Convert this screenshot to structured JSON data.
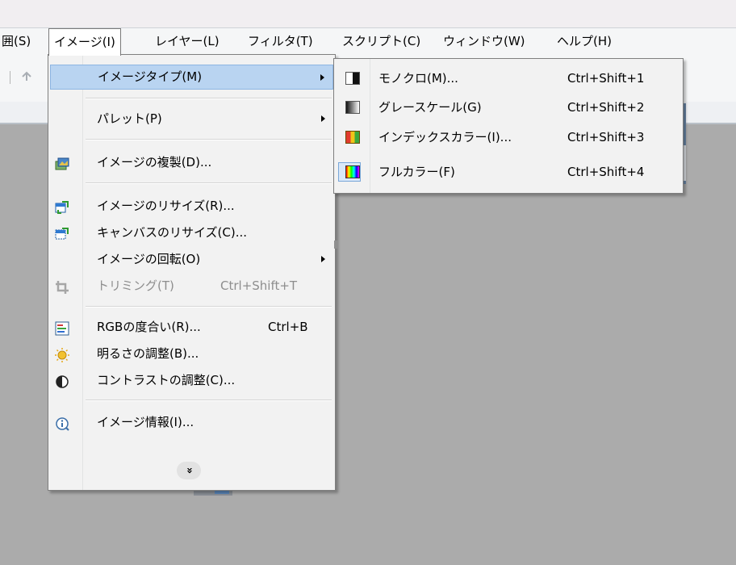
{
  "menubar": {
    "items": [
      {
        "label": "囲(S)"
      },
      {
        "label": "イメージ(I)"
      },
      {
        "label": "レイヤー(L)"
      },
      {
        "label": "フィルタ(T)"
      },
      {
        "label": "スクリプト(C)"
      },
      {
        "label": "ウィンドウ(W)"
      },
      {
        "label": "ヘルプ(H)"
      }
    ],
    "active_index": 1
  },
  "image_menu": {
    "items": [
      {
        "label": "イメージタイプ(M)",
        "has_submenu": true,
        "highlighted": true
      },
      {
        "label": "パレット(P)",
        "has_submenu": true
      },
      {
        "label": "イメージの複製(D)...",
        "icon": "duplicate-image-icon"
      },
      {
        "label": "イメージのリサイズ(R)...",
        "icon": "resize-image-icon"
      },
      {
        "label": "キャンバスのリサイズ(C)...",
        "icon": "resize-canvas-icon"
      },
      {
        "label": "イメージの回転(O)",
        "has_submenu": true
      },
      {
        "label": "トリミング(T)",
        "shortcut": "Ctrl+Shift+T",
        "icon": "crop-icon",
        "disabled": true
      },
      {
        "label": "RGBの度合い(R)...",
        "shortcut": "Ctrl+B",
        "icon": "rgb-levels-icon"
      },
      {
        "label": "明るさの調整(B)...",
        "icon": "brightness-icon"
      },
      {
        "label": "コントラストの調整(C)...",
        "icon": "contrast-icon"
      },
      {
        "label": "イメージ情報(I)...",
        "icon": "info-icon"
      }
    ],
    "more_glyph": "»"
  },
  "image_type_submenu": {
    "items": [
      {
        "label": "モノクロ(M)...",
        "shortcut": "Ctrl+Shift+1",
        "icon": "monochrome-icon"
      },
      {
        "label": "グレースケール(G)",
        "shortcut": "Ctrl+Shift+2",
        "icon": "grayscale-icon"
      },
      {
        "label": "インデックスカラー(I)...",
        "shortcut": "Ctrl+Shift+3",
        "icon": "indexed-color-icon"
      },
      {
        "label": "フルカラー(F)",
        "shortcut": "Ctrl+Shift+4",
        "icon": "full-color-icon",
        "checked": true
      }
    ]
  },
  "colors": {
    "highlight": "#b9d4f1",
    "workspace": "#ababab",
    "menu_bg": "#f2f2f2"
  }
}
